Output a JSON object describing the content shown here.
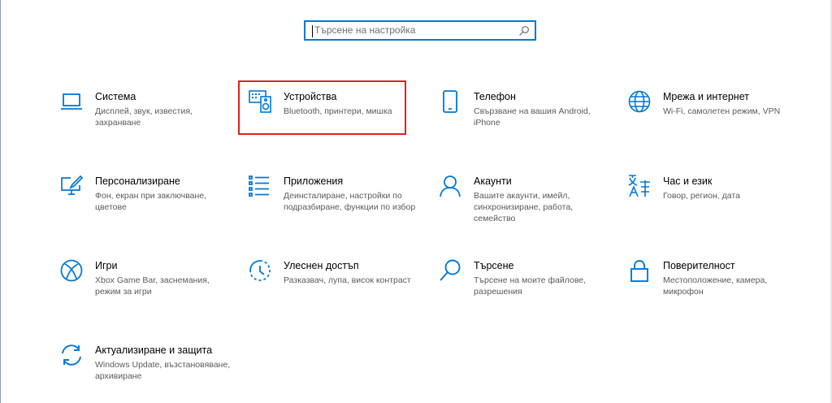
{
  "search": {
    "placeholder": "Търсене на настройка",
    "icon": "search-icon"
  },
  "accent_color": "#0078d7",
  "highlight_color": "#e02020",
  "tiles": [
    {
      "title": "Система",
      "desc": "Дисплей, звук, известия, захранване",
      "icon": "laptop-icon"
    },
    {
      "title": "Устройства",
      "desc": "Bluetooth, принтери, мишка",
      "icon": "keyboard-speaker-icon",
      "highlighted": true
    },
    {
      "title": "Телефон",
      "desc": "Свързване на вашия Android, iPhone",
      "icon": "phone-icon"
    },
    {
      "title": "Мрежа и интернет",
      "desc": "Wi-Fi, самолетен режим, VPN",
      "icon": "globe-icon"
    },
    {
      "title": "Персонализиране",
      "desc": "Фон, екран при заключване, цветове",
      "icon": "paint-monitor-icon"
    },
    {
      "title": "Приложения",
      "desc": "Деинсталиране, настройки по подразбиране, функции по избор",
      "icon": "app-list-icon"
    },
    {
      "title": "Акаунти",
      "desc": "Вашите акаунти, имейл, синхронизиране, работа, семейство",
      "icon": "person-icon"
    },
    {
      "title": "Час и език",
      "desc": "Говор, регион, дата",
      "icon": "time-language-icon"
    },
    {
      "title": "Игри",
      "desc": "Xbox Game Bar, заснемания, режим за игри",
      "icon": "xbox-icon"
    },
    {
      "title": "Улеснен достъп",
      "desc": "Разказвач, лупа, висок контраст",
      "icon": "ease-of-access-icon"
    },
    {
      "title": "Търсене",
      "desc": "Търсене на моите файлове, разрешения",
      "icon": "magnifier-icon"
    },
    {
      "title": "Поверителност",
      "desc": "Местоположение, камера, микрофон",
      "icon": "lock-icon"
    },
    {
      "title": "Актуализиране и защита",
      "desc": "Windows Update, възстановяване, архивиране",
      "icon": "sync-arrows-icon"
    }
  ]
}
